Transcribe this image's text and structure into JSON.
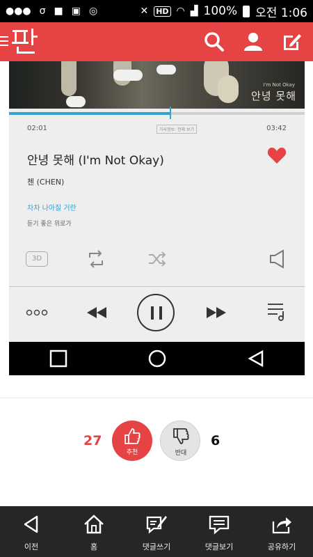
{
  "status_bar": {
    "network": "HD",
    "battery": "100%",
    "time": "오전 1:06"
  },
  "app": {
    "logo_text": "판",
    "accent": "#e64444"
  },
  "album_art": {
    "title": "안녕 못해",
    "subtitle": "I'm Not Okay"
  },
  "player": {
    "elapsed": "02:01",
    "duration": "03:42",
    "progress": 0.545,
    "lyrics_badge": "가사정보: 전체 보기",
    "song_title": "안녕 못해 (I'm Not Okay)",
    "artist": "첸 (CHEN)",
    "lyric_current": "차차 나아질 거란",
    "lyric_next": "듣기 좋은 위로가",
    "btn_3d": "3D",
    "liked": true,
    "accent": "#2da3d6"
  },
  "votes": {
    "up_count": "27",
    "up_label": "추천",
    "down_count": "6",
    "down_label": "반대"
  },
  "bottom_nav": [
    {
      "label": "이전",
      "icon": "back-icon"
    },
    {
      "label": "홈",
      "icon": "home-icon"
    },
    {
      "label": "댓글쓰기",
      "icon": "write-comment-icon"
    },
    {
      "label": "댓글보기",
      "icon": "view-comments-icon"
    },
    {
      "label": "공유하기",
      "icon": "share-icon"
    }
  ]
}
